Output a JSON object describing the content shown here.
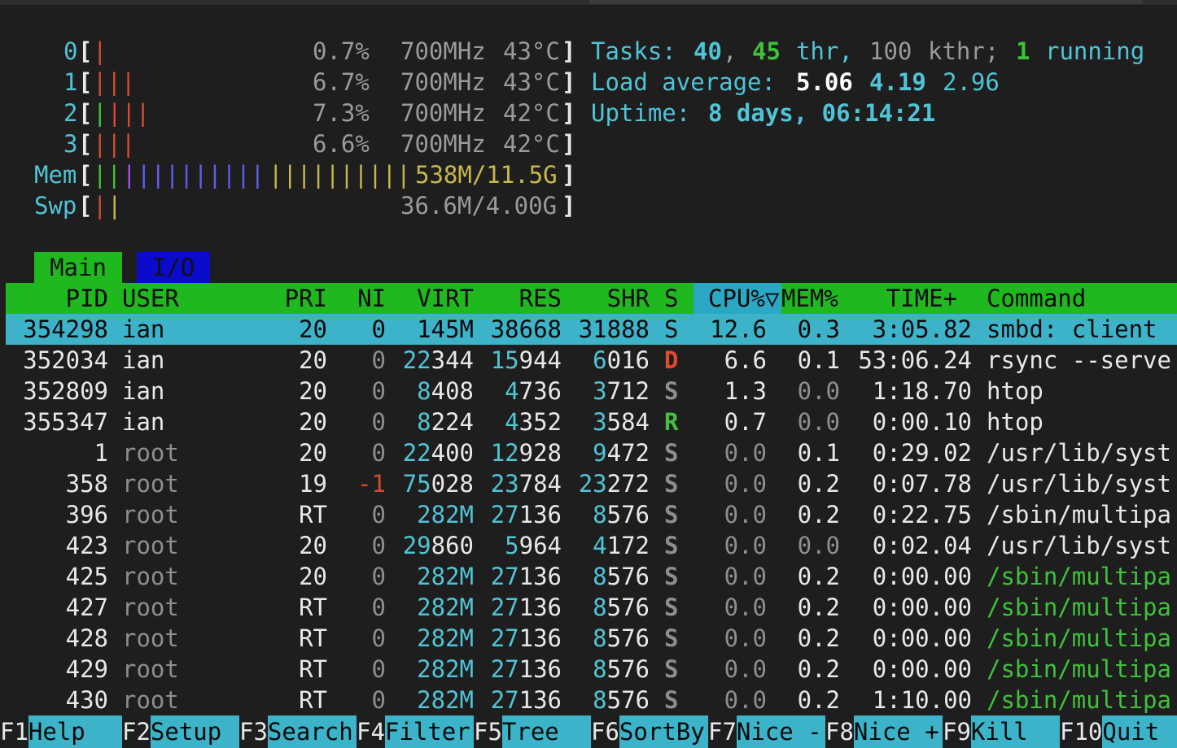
{
  "meters": {
    "cpus": [
      {
        "id": "0",
        "pct": "0.7%",
        "freq": "700MHz",
        "temp": "43°C"
      },
      {
        "id": "1",
        "pct": "6.7%",
        "freq": "700MHz",
        "temp": "43°C"
      },
      {
        "id": "2",
        "pct": "7.3%",
        "freq": "700MHz",
        "temp": "42°C"
      },
      {
        "id": "3",
        "pct": "6.6%",
        "freq": "700MHz",
        "temp": "42°C"
      }
    ],
    "mem_label": "Mem",
    "mem_value": "538M/11.5G",
    "swp_label": "Swp",
    "swp_value": "36.6M/4.00G"
  },
  "summary": {
    "tasks_label": "Tasks:",
    "tasks": "40",
    "thr": "45",
    "thr_label": "thr,",
    "kthr": "100",
    "kthr_label": "kthr;",
    "running": "1",
    "running_label": "running",
    "load_label": "Load average:",
    "load1": "5.06",
    "load5": "4.19",
    "load15": "2.96",
    "uptime_label": "Uptime:",
    "uptime": "8 days, 06:14:21"
  },
  "tabs": [
    "Main",
    "I/O"
  ],
  "columns": {
    "pid": "PID",
    "user": "USER",
    "pri": "PRI",
    "ni": "NI",
    "virt": "VIRT",
    "res": "RES",
    "shr": "SHR",
    "s": "S",
    "cpu": "CPU%▽",
    "mem": "MEM%",
    "time": "TIME+",
    "command": "Command"
  },
  "processes": [
    {
      "pid": "354298",
      "user": "ian",
      "pri": "20",
      "ni": "0",
      "virt": "145M",
      "res": "38668",
      "shr": "31888",
      "s": "S",
      "cpu": "12.6",
      "mem": "0.3",
      "time": "3:05.82",
      "command": "smbd: client"
    },
    {
      "pid": "352034",
      "user": "ian",
      "pri": "20",
      "ni": "0",
      "virt": "22344",
      "res": "15944",
      "shr": "6016",
      "s": "D",
      "cpu": "6.6",
      "mem": "0.1",
      "time": "53:06.24",
      "command": "rsync --serve"
    },
    {
      "pid": "352809",
      "user": "ian",
      "pri": "20",
      "ni": "0",
      "virt": "8408",
      "res": "4736",
      "shr": "3712",
      "s": "S",
      "cpu": "1.3",
      "mem": "0.0",
      "time": "1:18.70",
      "command": "htop"
    },
    {
      "pid": "355347",
      "user": "ian",
      "pri": "20",
      "ni": "0",
      "virt": "8224",
      "res": "4352",
      "shr": "3584",
      "s": "R",
      "cpu": "0.7",
      "mem": "0.0",
      "time": "0:00.10",
      "command": "htop"
    },
    {
      "pid": "1",
      "user": "root",
      "pri": "20",
      "ni": "0",
      "virt": "22400",
      "res": "12928",
      "shr": "9472",
      "s": "S",
      "cpu": "0.0",
      "mem": "0.1",
      "time": "0:29.02",
      "command": "/usr/lib/syst"
    },
    {
      "pid": "358",
      "user": "root",
      "pri": "19",
      "ni": "-1",
      "virt": "75028",
      "res": "23784",
      "shr": "23272",
      "s": "S",
      "cpu": "0.0",
      "mem": "0.2",
      "time": "0:07.78",
      "command": "/usr/lib/syst"
    },
    {
      "pid": "396",
      "user": "root",
      "pri": "RT",
      "ni": "0",
      "virt": "282M",
      "res": "27136",
      "shr": "8576",
      "s": "S",
      "cpu": "0.0",
      "mem": "0.2",
      "time": "0:22.75",
      "command": "/sbin/multipa"
    },
    {
      "pid": "423",
      "user": "root",
      "pri": "20",
      "ni": "0",
      "virt": "29860",
      "res": "5964",
      "shr": "4172",
      "s": "S",
      "cpu": "0.0",
      "mem": "0.0",
      "time": "0:02.04",
      "command": "/usr/lib/syst"
    },
    {
      "pid": "425",
      "user": "root",
      "pri": "20",
      "ni": "0",
      "virt": "282M",
      "res": "27136",
      "shr": "8576",
      "s": "S",
      "cpu": "0.0",
      "mem": "0.2",
      "time": "0:00.00",
      "command": "/sbin/multipa"
    },
    {
      "pid": "427",
      "user": "root",
      "pri": "RT",
      "ni": "0",
      "virt": "282M",
      "res": "27136",
      "shr": "8576",
      "s": "S",
      "cpu": "0.0",
      "mem": "0.2",
      "time": "0:00.00",
      "command": "/sbin/multipa"
    },
    {
      "pid": "428",
      "user": "root",
      "pri": "RT",
      "ni": "0",
      "virt": "282M",
      "res": "27136",
      "shr": "8576",
      "s": "S",
      "cpu": "0.0",
      "mem": "0.2",
      "time": "0:00.00",
      "command": "/sbin/multipa"
    },
    {
      "pid": "429",
      "user": "root",
      "pri": "RT",
      "ni": "0",
      "virt": "282M",
      "res": "27136",
      "shr": "8576",
      "s": "S",
      "cpu": "0.0",
      "mem": "0.2",
      "time": "0:00.00",
      "command": "/sbin/multipa"
    },
    {
      "pid": "430",
      "user": "root",
      "pri": "RT",
      "ni": "0",
      "virt": "282M",
      "res": "27136",
      "shr": "8576",
      "s": "S",
      "cpu": "0.0",
      "mem": "0.2",
      "time": "1:10.00",
      "command": "/sbin/multipa"
    }
  ],
  "footer": [
    {
      "key": "F1",
      "label": "Help"
    },
    {
      "key": "F2",
      "label": "Setup"
    },
    {
      "key": "F3",
      "label": "Search"
    },
    {
      "key": "F4",
      "label": "Filter"
    },
    {
      "key": "F5",
      "label": "Tree"
    },
    {
      "key": "F6",
      "label": "SortBy"
    },
    {
      "key": "F7",
      "label": "Nice -"
    },
    {
      "key": "F8",
      "label": "Nice +"
    },
    {
      "key": "F9",
      "label": "Kill"
    },
    {
      "key": "F10",
      "label": "Quit"
    }
  ],
  "colors": {
    "background": "#1e1e1e",
    "header_green": "#1fb81f",
    "selected_row": "#3cb3c9",
    "io_tab_blue": "#0b0bcc",
    "cyan": "#4fc4d6",
    "state_D": "#e24a30",
    "state_R": "#3ec23a"
  }
}
